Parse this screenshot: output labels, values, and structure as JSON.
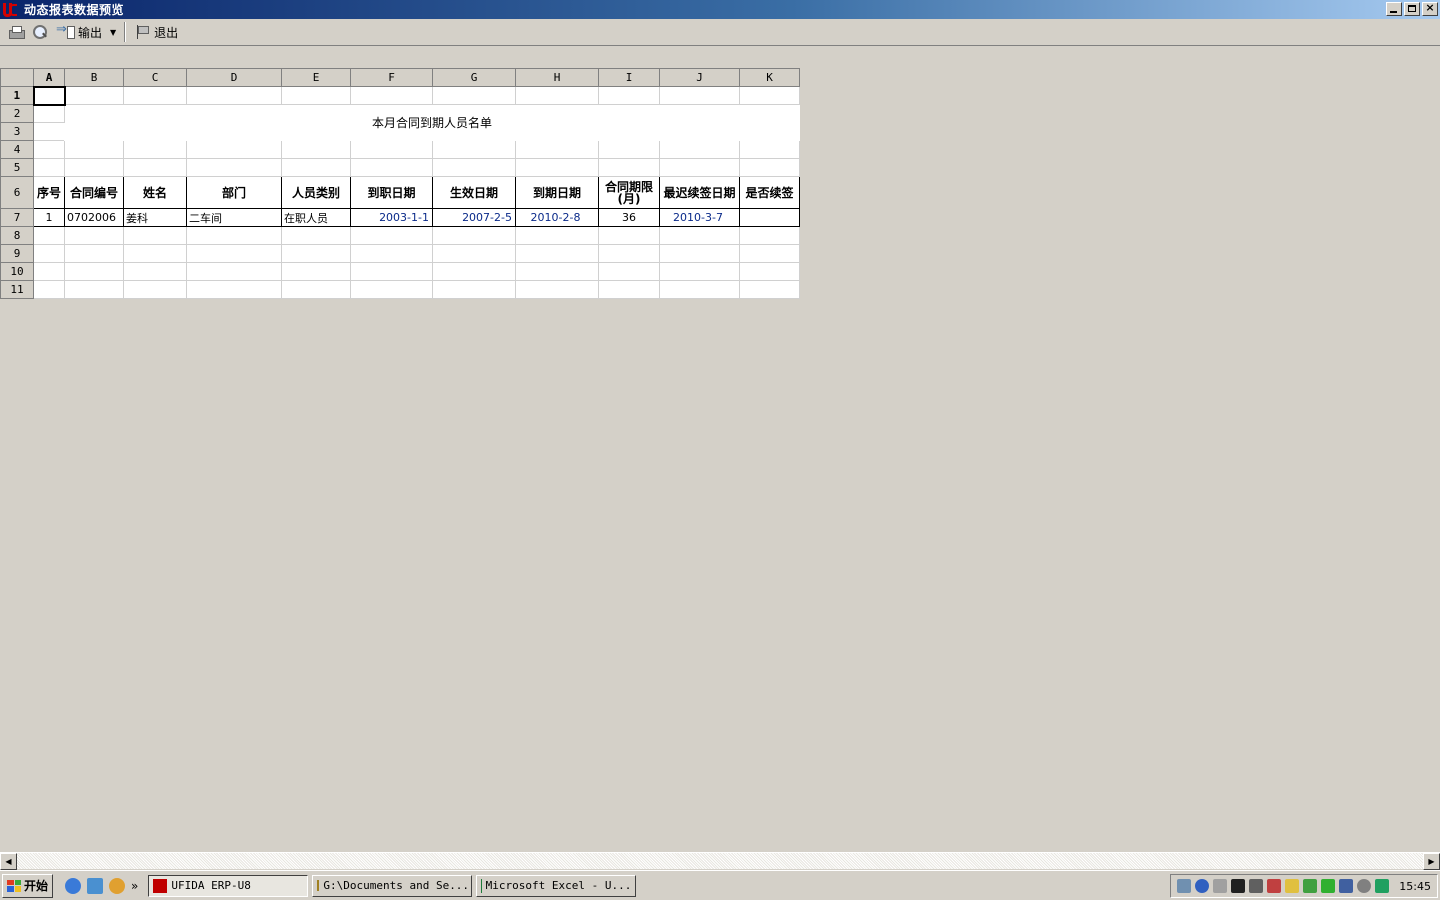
{
  "window": {
    "title": "动态报表数据预览"
  },
  "toolbar": {
    "export_label": "输出",
    "exit_label": "退出"
  },
  "sheet": {
    "columns": [
      "A",
      "B",
      "C",
      "D",
      "E",
      "F",
      "G",
      "H",
      "I",
      "J",
      "K"
    ],
    "rows": [
      "1",
      "2",
      "3",
      "4",
      "5",
      "6",
      "7",
      "8",
      "9",
      "10",
      "11"
    ],
    "title": "本月合同到期人员名单",
    "headers": [
      "序号",
      "合同编号",
      "姓名",
      "部门",
      "人员类别",
      "到职日期",
      "生效日期",
      "到期日期",
      "合同期限(月)",
      "最迟续签日期",
      "是否续签"
    ],
    "record": {
      "no": "1",
      "contract_no": "0702006",
      "name": "姜科",
      "dept": "二车间",
      "category": "在职人员",
      "join_date": "2003-1-1",
      "effective_date": "2007-2-5",
      "expire_date": "2010-2-8",
      "term_months": "36",
      "renew_deadline": "2010-3-7",
      "renewed": ""
    }
  },
  "taskbar": {
    "start_label": "开始",
    "more": "»",
    "tasks": [
      {
        "label": "UFIDA ERP-U8",
        "active": true
      },
      {
        "label": "G:\\Documents and Se...",
        "active": false
      },
      {
        "label": "Microsoft Excel - U...",
        "active": false
      }
    ],
    "clock": "15:45"
  },
  "colors": {
    "date_blue": "#0a2a8a",
    "titlebar_dark": "#0a246a",
    "titlebar_light": "#a6caf0"
  }
}
